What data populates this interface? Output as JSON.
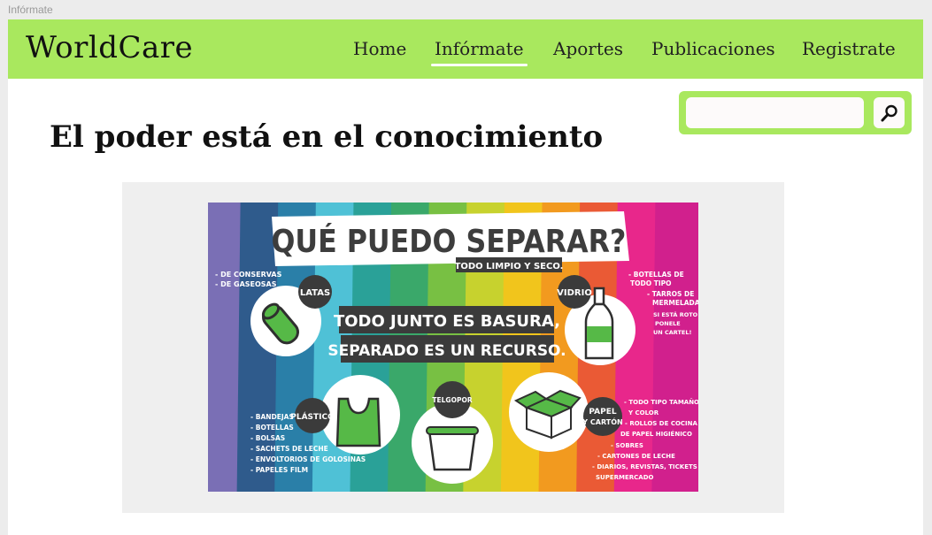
{
  "browser": {
    "tab_title": "Infórmate"
  },
  "navbar": {
    "brand": "WorldCare",
    "links": [
      {
        "label": "Home",
        "active": false
      },
      {
        "label": "Infórmate",
        "active": true
      },
      {
        "label": "Aportes",
        "active": false
      },
      {
        "label": "Publicaciones",
        "active": false
      },
      {
        "label": "Registrate",
        "active": false
      }
    ]
  },
  "search": {
    "placeholder": "",
    "icon": "magnifier-icon"
  },
  "main": {
    "heading": "El poder está en el conocimiento"
  },
  "poster": {
    "title": "QUÉ PUEDO SEPARAR?",
    "subtitle": "TODO LIMPIO Y SECO.",
    "center_line1": "TODO JUNTO ES BASURA,",
    "center_line2": "SEPARADO ES UN RECURSO.",
    "latas": {
      "label": "LATAS",
      "items": [
        "- DE CONSERVAS",
        "- DE GASEOSAS"
      ]
    },
    "vidrio": {
      "label": "VIDRIO",
      "items": [
        "- BOTELLAS DE",
        "TODO TIPO",
        "- TARROS DE",
        "MERMELADA",
        "SI ESTÁ ROTO",
        "PONELE",
        "UN CARTEL!"
      ]
    },
    "plastico": {
      "label": "PLÁSTICO",
      "items": [
        "- BANDEJAS",
        "- BOTELLAS",
        "- BOLSAS",
        "- SACHETS DE LECHE",
        "- ENVOLTORIOS DE GOLOSINAS",
        "- PAPELES FILM"
      ]
    },
    "telgopor": {
      "label": "TELGOPOR"
    },
    "papel": {
      "label_line1": "PAPEL",
      "label_line2": "Y CARTÓN",
      "items": [
        "- TODO TIPO TAMAÑO",
        "Y COLOR",
        "- ROLLOS DE COCINA Y",
        "DE PAPEL HIGIÉNICO",
        "- SOBRES",
        "- CARTONES DE LECHE",
        "- DIARIOS, REVISTAS, TICKETS DE",
        "SUPERMERCADO"
      ]
    },
    "stripe_colors": [
      "#7a6fb5",
      "#2f5b8c",
      "#2a7fa8",
      "#4fc1d6",
      "#2aa198",
      "#3aa86a",
      "#78c043",
      "#c7d22e",
      "#f1c51c",
      "#f29a1f",
      "#ea5a35",
      "#e8278b",
      "#d1208d"
    ]
  }
}
